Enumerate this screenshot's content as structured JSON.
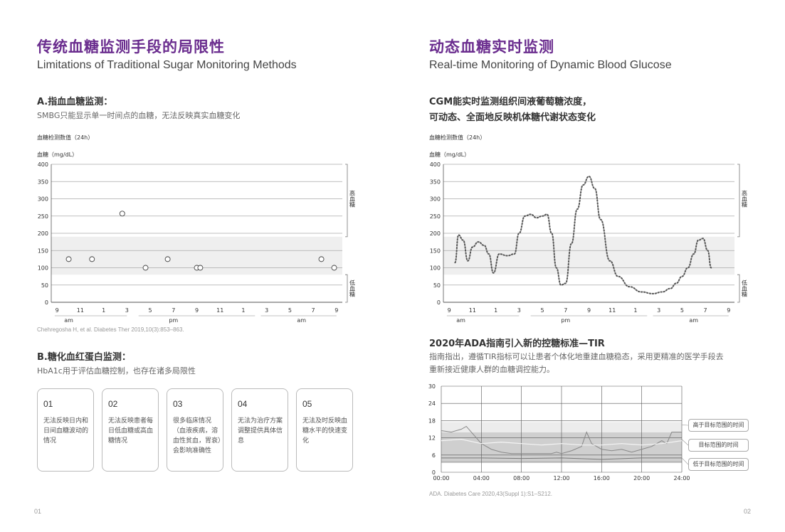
{
  "left": {
    "title": "传统血糖监测手段的局限性",
    "subtitle": "Limitations of Traditional Sugar Monitoring Methods",
    "sectionA": {
      "heading": "A.指血血糖监测：",
      "desc": "SMBG只能显示单一时间点的血糖，无法反映真实血糖变化"
    },
    "chart_caption": "血糖检测数值（24h）",
    "reference": "Chehregosha H, et al. Diabetes Ther 2019,10(3):853–863.",
    "sectionB": {
      "heading": "B.糖化血红蛋白监测：",
      "desc": "HbA1c用于评估血糖控制，也存在诸多局限性"
    },
    "cards": [
      {
        "num": "01",
        "text": "无法反映日内和日间血糖波动的情况"
      },
      {
        "num": "02",
        "text": "无法反映患者每日低血糖或高血糖情况"
      },
      {
        "num": "03",
        "text": "很多临床情况（血液疾病，溶血性贫血，胃衰）会影响准确性"
      },
      {
        "num": "04",
        "text": "无法为治疗方案调整提供具体信息"
      },
      {
        "num": "05",
        "text": "无法及时反映血糖水平的快速变化"
      }
    ],
    "page_num": "01"
  },
  "right": {
    "title": "动态血糖实时监测",
    "subtitle": "Real-time Monitoring of Dynamic Blood Glucose",
    "cgm_line1": "CGM能实时监测组织间液葡萄糖浓度，",
    "cgm_line2": "可动态、全面地反映机体糖代谢状态变化",
    "chart_caption": "血糖检测数值（24h）",
    "tir_heading": "2020年ADA指南引入新的控糖标准—TIR",
    "tir_desc1": "指南指出，遵循TIR指标可以让患者个体化地重建血糖稳态，采用更精准的医学手段去",
    "tir_desc2": "重新接近健康人群的血糖调控能力。",
    "legend": [
      "高于目标范围的时间",
      "目标范围的时间",
      "低于目标范围的时间"
    ],
    "reference": "ADA. Diabetes Care 2020,43(Suppl 1):S1–S212.",
    "page_num": "02"
  },
  "chart_data": [
    {
      "type": "scatter",
      "title": "血糖检测数值（24h）",
      "ylabel": "血糖（mg/dL）",
      "ylim": [
        0,
        400
      ],
      "yticks": [
        0,
        50,
        100,
        150,
        200,
        250,
        300,
        350,
        400
      ],
      "xticks": [
        "9",
        "11",
        "1",
        "3",
        "5",
        "7",
        "9",
        "11",
        "1",
        "3",
        "5",
        "7",
        "9"
      ],
      "periods": [
        "am",
        "pm",
        "am"
      ],
      "bracket_labels": [
        "高血糖",
        "低血糖"
      ],
      "target_band": [
        80,
        190
      ],
      "points": [
        [
          10,
          125
        ],
        [
          12,
          125
        ],
        [
          14.6,
          257
        ],
        [
          16.6,
          100
        ],
        [
          18.5,
          125
        ],
        [
          21,
          100
        ],
        [
          21.3,
          100
        ],
        [
          31.7,
          125
        ],
        [
          32.8,
          100
        ]
      ]
    },
    {
      "type": "line",
      "title": "血糖检测数值（24h）",
      "ylabel": "血糖（mg/dL）",
      "ylim": [
        0,
        400
      ],
      "yticks": [
        0,
        50,
        100,
        150,
        200,
        250,
        300,
        350,
        400
      ],
      "xticks": [
        "9",
        "11",
        "1",
        "3",
        "5",
        "7",
        "9",
        "11",
        "1",
        "3",
        "5",
        "7",
        "9"
      ],
      "periods": [
        "am",
        "pm",
        "am"
      ],
      "bracket_labels": [
        "高血糖",
        "低血糖"
      ],
      "target_band": [
        80,
        190
      ],
      "x": [
        9.5,
        9.8,
        10.2,
        10.6,
        11,
        11.5,
        12,
        12.4,
        12.8,
        13.3,
        14,
        14.6,
        15,
        15.5,
        16,
        16.5,
        17,
        17.4,
        17.8,
        18.2,
        18.6,
        19,
        19.5,
        20,
        20.5,
        21,
        21.5,
        22,
        22.8,
        23.5,
        24.5,
        25.5,
        26.5,
        27.3,
        28,
        28.5,
        29,
        29.5,
        30,
        30.4,
        30.8,
        31.2,
        31.5
      ],
      "y": [
        115,
        195,
        180,
        120,
        160,
        175,
        165,
        140,
        85,
        140,
        135,
        140,
        200,
        250,
        255,
        245,
        250,
        255,
        200,
        100,
        50,
        55,
        170,
        270,
        340,
        365,
        330,
        240,
        120,
        75,
        45,
        30,
        25,
        30,
        40,
        55,
        75,
        100,
        140,
        180,
        185,
        150,
        100
      ]
    },
    {
      "type": "line",
      "title": "",
      "ylim": [
        0,
        30
      ],
      "yticks": [
        0,
        6,
        12,
        18,
        24,
        30
      ],
      "xticks": [
        "00:00",
        "04:00",
        "08:00",
        "12:00",
        "16:00",
        "20:00",
        "24:00"
      ],
      "bands": {
        "above": [
          13.9,
          17.5
        ],
        "target": [
          3.9,
          13.9
        ],
        "below": [
          3.3,
          3.9
        ]
      },
      "series": [
        {
          "x": [
            0,
            1,
            2,
            2.5,
            3,
            4,
            5,
            6,
            7,
            8,
            9,
            10,
            11,
            11.5,
            12,
            13,
            14,
            14.5,
            15,
            16,
            17,
            18,
            19,
            20,
            21,
            22,
            22.5,
            23,
            24
          ],
          "y": [
            14.5,
            14,
            15,
            16,
            14,
            10,
            8,
            7,
            6.5,
            6.5,
            6.5,
            6.5,
            6.5,
            7,
            6.5,
            7.5,
            9,
            14,
            10,
            8,
            7.5,
            8,
            7,
            8,
            9,
            11,
            10,
            14,
            14
          ]
        },
        {
          "x": [
            0,
            2,
            4,
            6,
            8,
            10,
            12,
            14,
            16,
            18,
            20,
            22,
            24
          ],
          "y": [
            11,
            11.5,
            10,
            10.5,
            10,
            9.5,
            10,
            9.5,
            9.5,
            10,
            9.5,
            10,
            11
          ]
        },
        {
          "x": [
            0,
            4,
            8,
            12,
            16,
            20,
            24
          ],
          "y": [
            5,
            5,
            4.8,
            5,
            4.5,
            5,
            5
          ]
        }
      ]
    }
  ]
}
